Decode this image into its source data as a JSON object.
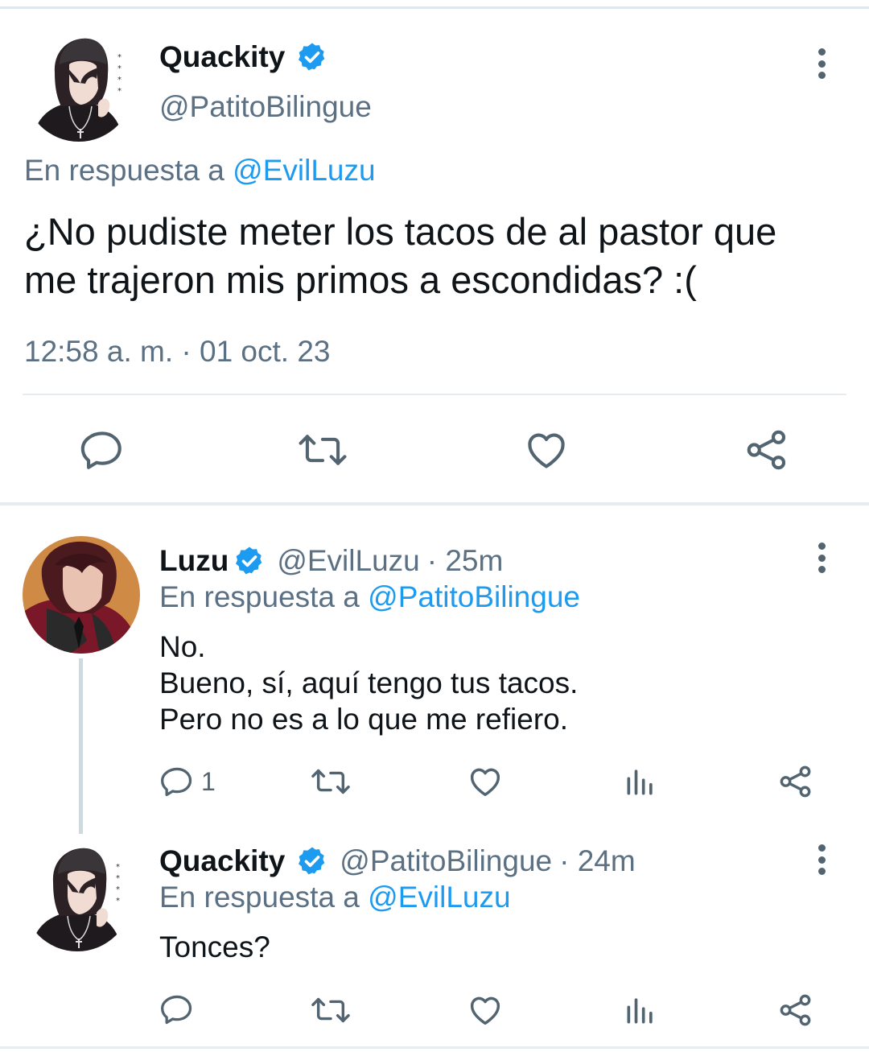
{
  "main_tweet": {
    "author_name": "Quackity",
    "handle": "@PatitoBilingue",
    "reply_prefix": "En respuesta a",
    "reply_to": "@EvilLuzu",
    "text_line1": "¿No pudiste meter los tacos de al pastor que",
    "text_line2": "me trajeron mis primos a escondidas? :(",
    "timestamp": "12:58 a. m. · 01 oct. 23"
  },
  "reply1": {
    "author_name": "Luzu",
    "handle": "@EvilLuzu",
    "time": "· 25m",
    "reply_prefix": "En respuesta a",
    "reply_to": "@PatitoBilingue",
    "text_line1": "No.",
    "text_line2": "Bueno, sí, aquí tengo tus tacos.",
    "text_line3": "Pero no es a lo que me refiero.",
    "reply_count": "1"
  },
  "reply2": {
    "author_name": "Quackity",
    "handle": "@PatitoBilingue",
    "time": "· 24m",
    "reply_prefix": "En respuesta a",
    "reply_to": "@EvilLuzu",
    "text_line1": "Tonces?"
  },
  "icons": {
    "verified": "verified-badge-icon",
    "reply": "reply-bubble-icon",
    "retweet": "retweet-icon",
    "like": "heart-icon",
    "analytics": "bar-chart-icon",
    "share": "share-icon",
    "more": "more-vertical-icon"
  },
  "colors": {
    "link": "#1d9bf0",
    "muted": "#5b7083",
    "verified": "#1d9bf0",
    "icon": "#536471"
  }
}
